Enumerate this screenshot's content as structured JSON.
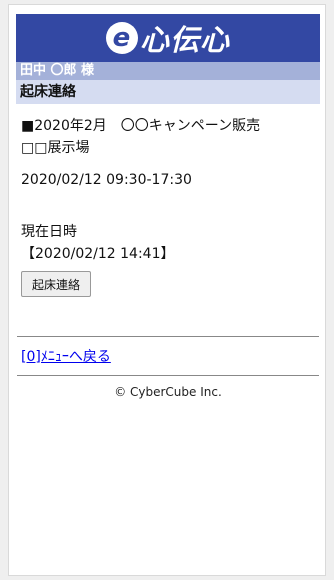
{
  "header": {
    "logo_e": "e",
    "logo_text": "心伝心",
    "brand_color": "#3348a3"
  },
  "user": {
    "name_label": "田中 〇郎 様"
  },
  "page": {
    "title": "起床連絡"
  },
  "event": {
    "line1": "■2020年2月　〇〇キャンペーン販売",
    "line2": "□□展示場",
    "datetime": "2020/02/12 09:30-17:30"
  },
  "current": {
    "label": "現在日時",
    "value": "【2020/02/12 14:41】"
  },
  "actions": {
    "wake_button": "起床連絡"
  },
  "nav": {
    "back_link": "[0]ﾒﾆｭｰへ戻る"
  },
  "footer": {
    "copyright": "© CyberCube Inc."
  }
}
